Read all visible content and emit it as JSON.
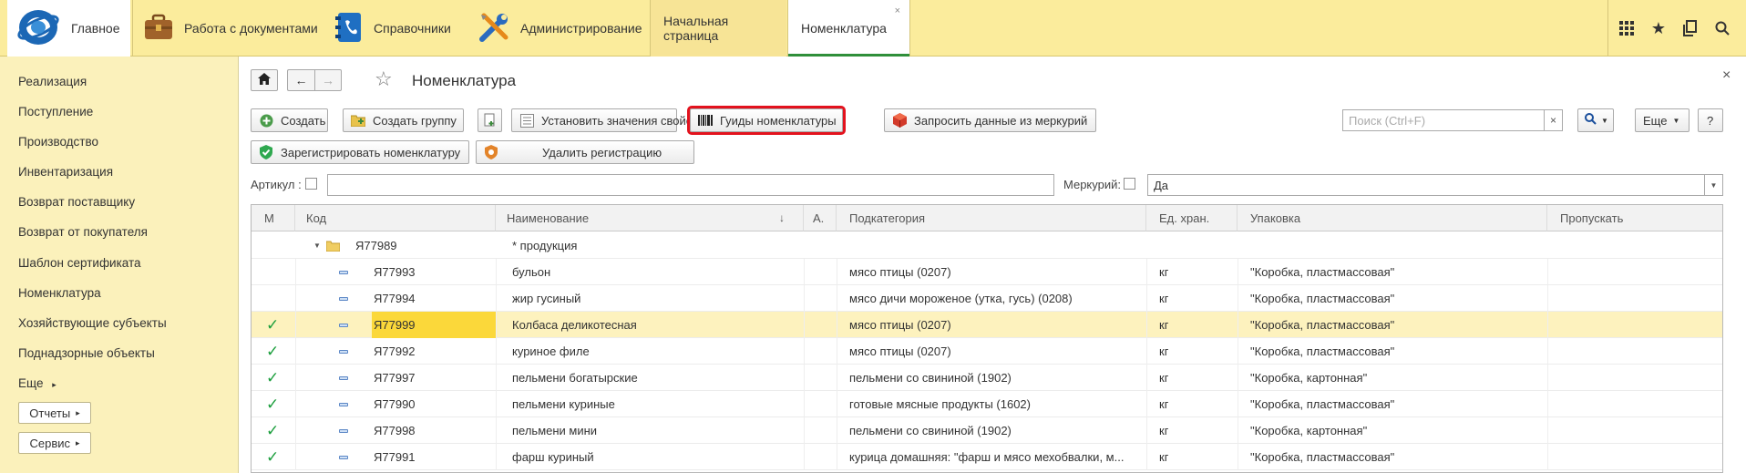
{
  "topbar": {
    "sections": [
      {
        "label": "Главное",
        "icon": "app-logo-icon"
      },
      {
        "label": "Работа с документами",
        "icon": "briefcase-icon"
      },
      {
        "label": "Справочники",
        "icon": "address-book-icon"
      },
      {
        "label": "Администрирование",
        "icon": "tools-icon"
      }
    ],
    "open_tabs": [
      {
        "label": "Начальная страница"
      },
      {
        "label": "Номенклатура",
        "close": "×"
      }
    ],
    "tools": [
      "apps-grid-icon",
      "star-icon",
      "history-icon",
      "search-icon"
    ]
  },
  "sidebar": {
    "items": [
      {
        "label": "Реализация",
        "bold": true
      },
      {
        "label": "Поступление",
        "bold": true
      },
      {
        "label": "Производство",
        "bold": true
      },
      {
        "label": "Инвентаризация",
        "bold": true
      },
      {
        "label": "Возврат поставщику",
        "bold": true
      },
      {
        "label": "Возврат от покупателя",
        "bold": true
      },
      {
        "label": "Шаблон сертификата",
        "bold": false
      },
      {
        "label": "Номенклатура",
        "bold": false
      },
      {
        "label": "Хозяйствующие субъекты",
        "bold": false
      },
      {
        "label": "Поднадзорные объекты",
        "bold": false
      },
      {
        "label": "Еще",
        "bold": false
      }
    ],
    "buttons": [
      {
        "label": "Отчеты"
      },
      {
        "label": "Сервис"
      }
    ]
  },
  "main": {
    "title": "Номенклатура",
    "close": "×",
    "toolbar": {
      "create": "Создать",
      "create_group": "Создать группу",
      "set_properties": "Установить значения свойств",
      "guids": "Гуиды номенклатуры",
      "request_mercury": "Запросить данные из меркурий",
      "register": "Зарегистрировать номенклатуру",
      "unregister": "Удалить регистрацию",
      "search_placeholder": "Поиск (Ctrl+F)",
      "search_clear": "×",
      "more": "Еще",
      "help": "?"
    },
    "filters": {
      "article_label": "Артикул :",
      "mercury_label": "Меркурий:",
      "mercury_value": "Да"
    },
    "table": {
      "columns": [
        "М",
        "Код",
        "Наименование",
        "А.",
        "Подкатегория",
        "Ед. хран.",
        "Упаковка",
        "Пропускать"
      ],
      "sort_marker": "↓",
      "group": {
        "code": "Я77989",
        "name": "* продукция"
      },
      "rows": [
        {
          "m": "",
          "code": "Я77993",
          "name": "бульон",
          "subcategory": "мясо птицы (0207)",
          "unit": "кг",
          "package": "\"Коробка, пластмассовая\"",
          "selected": false
        },
        {
          "m": "",
          "code": "Я77994",
          "name": "жир гусиный",
          "subcategory": "мясо дичи мороженое (утка, гусь) (0208)",
          "unit": "кг",
          "package": "\"Коробка, пластмассовая\"",
          "selected": false
        },
        {
          "m": "✓",
          "code": "Я77999",
          "name": "Колбаса деликотесная",
          "subcategory": "мясо птицы (0207)",
          "unit": "кг",
          "package": "\"Коробка, пластмассовая\"",
          "selected": true
        },
        {
          "m": "✓",
          "code": "Я77992",
          "name": "куриное филе",
          "subcategory": "мясо птицы (0207)",
          "unit": "кг",
          "package": "\"Коробка, пластмассовая\"",
          "selected": false
        },
        {
          "m": "✓",
          "code": "Я77997",
          "name": "пельмени богатырские",
          "subcategory": "пельмени со свининой (1902)",
          "unit": "кг",
          "package": "\"Коробка, картонная\"",
          "selected": false
        },
        {
          "m": "✓",
          "code": "Я77990",
          "name": "пельмени куриные",
          "subcategory": "готовые мясные продукты (1602)",
          "unit": "кг",
          "package": "\"Коробка, пластмассовая\"",
          "selected": false
        },
        {
          "m": "✓",
          "code": "Я77998",
          "name": "пельмени мини",
          "subcategory": "пельмени со свининой (1902)",
          "unit": "кг",
          "package": "\"Коробка, картонная\"",
          "selected": false
        },
        {
          "m": "✓",
          "code": "Я77991",
          "name": "фарш куриный",
          "subcategory": "курица домашняя: \"фарш и мясо мехобвалки, м...",
          "unit": "кг",
          "package": "\"Коробка, пластмассовая\"",
          "selected": false
        }
      ]
    }
  },
  "colors": {
    "topbar_bg": "#fbec9c",
    "sidebar_bg": "#fbf1bb",
    "selected_row": "#fdf2be",
    "cursor_cell": "#fbd83a",
    "highlight_border": "#e3121d",
    "check_green": "#1a9e3c"
  }
}
